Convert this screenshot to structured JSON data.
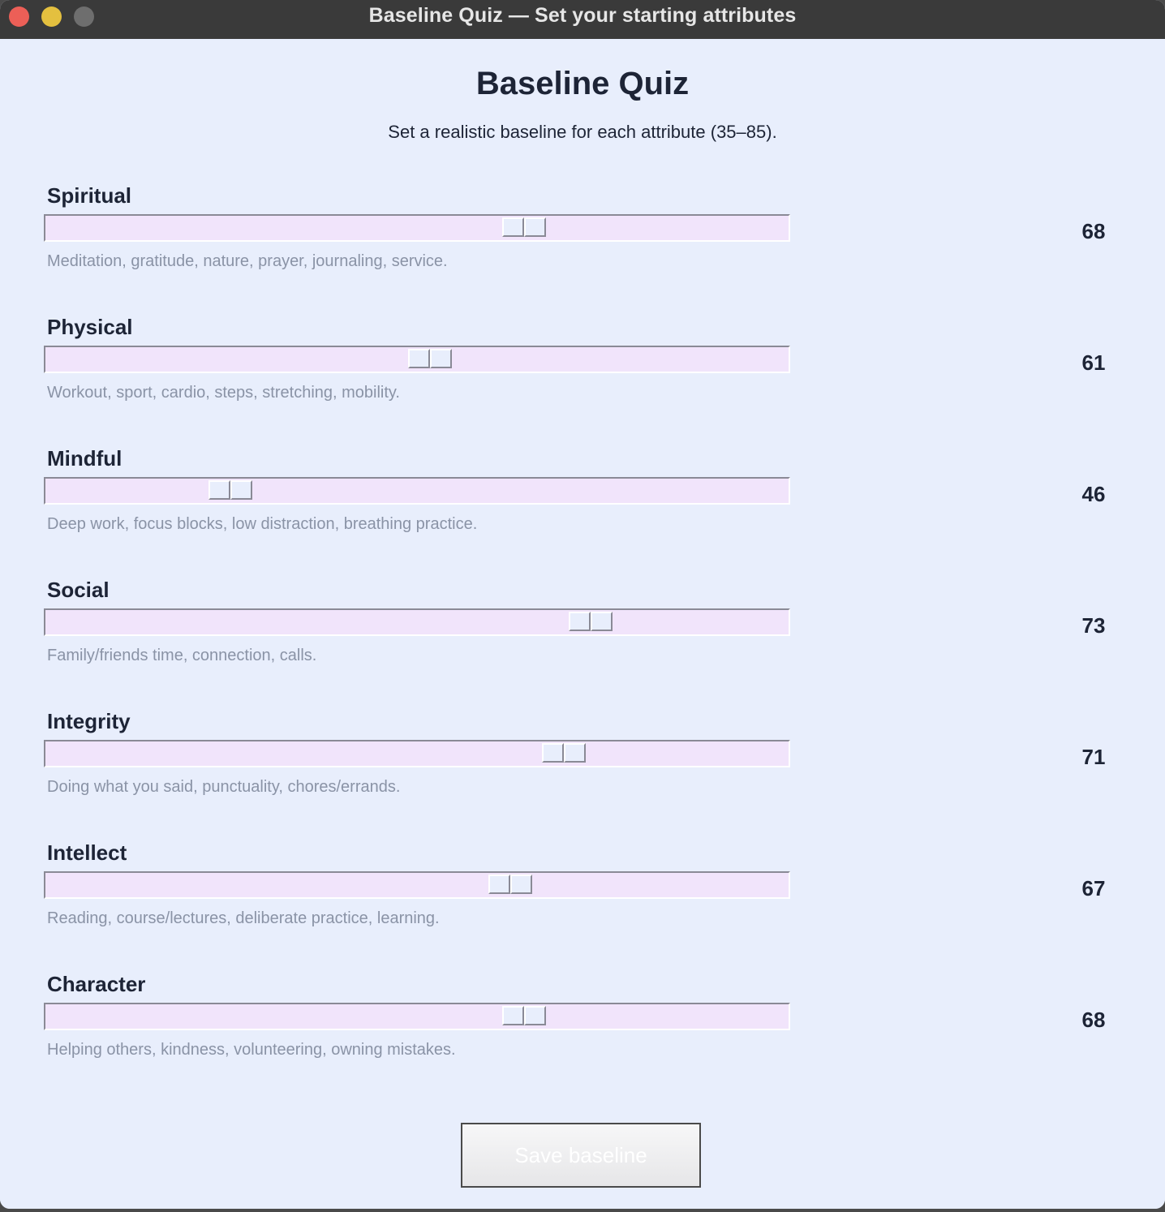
{
  "window": {
    "title": "Baseline Quiz — Set your starting attributes"
  },
  "page": {
    "title": "Baseline Quiz",
    "subtitle": "Set a realistic baseline for each attribute (35–85)."
  },
  "slider_range": {
    "min": 35,
    "max": 85
  },
  "attributes": [
    {
      "name": "Spiritual",
      "value": 68,
      "value_label": "68",
      "description": "Meditation, gratitude, nature, prayer, journaling, service."
    },
    {
      "name": "Physical",
      "value": 61,
      "value_label": "61",
      "description": "Workout, sport, cardio, steps, stretching, mobility."
    },
    {
      "name": "Mindful",
      "value": 46,
      "value_label": "46",
      "description": "Deep work, focus blocks, low distraction, breathing practice."
    },
    {
      "name": "Social",
      "value": 73,
      "value_label": "73",
      "description": "Family/friends time, connection, calls."
    },
    {
      "name": "Integrity",
      "value": 71,
      "value_label": "71",
      "description": "Doing what you said, punctuality, chores/errands."
    },
    {
      "name": "Intellect",
      "value": 67,
      "value_label": "67",
      "description": "Reading, course/lectures, deliberate practice, learning."
    },
    {
      "name": "Character",
      "value": 68,
      "value_label": "68",
      "description": "Helping others, kindness, volunteering, owning mistakes."
    }
  ],
  "save_button": {
    "label": "Save baseline"
  }
}
